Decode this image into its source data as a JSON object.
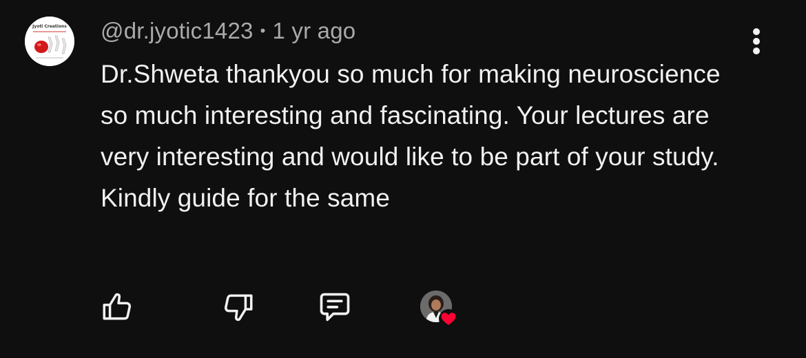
{
  "comment": {
    "author": "@dr.jyotic1423",
    "separator": "•",
    "time": "1 yr ago",
    "text": "Dr.Shweta thankyou so much for making neuroscience so much interesting and fascinating. Your lectures are very interesting and would like to be part of your study. Kindly guide for the same",
    "avatar_caption": "Jyoti Creations"
  },
  "icons": {
    "menu": "more-vertical-icon",
    "like": "thumbs-up-icon",
    "dislike": "thumbs-down-icon",
    "reply": "reply-comment-icon",
    "creator_heart": "heart-icon"
  },
  "colors": {
    "background": "#0f0f0f",
    "text": "#f1f1f1",
    "meta": "#aaaaaa",
    "heart": "#ff0033"
  }
}
